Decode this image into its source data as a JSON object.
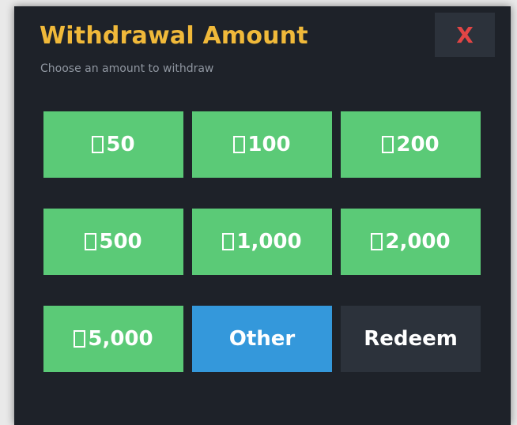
{
  "dialog": {
    "title": "Withdrawal Amount",
    "subtitle": "Choose an amount to withdraw",
    "close_label": "X"
  },
  "amounts": [
    {
      "label": "50",
      "currency_icon": "currency-glyph-box",
      "color": "#5bca77"
    },
    {
      "label": "100",
      "currency_icon": "currency-glyph-box",
      "color": "#5bca77"
    },
    {
      "label": "200",
      "currency_icon": "currency-glyph-box",
      "color": "#5bca77"
    },
    {
      "label": "500",
      "currency_icon": "currency-glyph-box",
      "color": "#5bca77"
    },
    {
      "label": "1,000",
      "currency_icon": "currency-glyph-box",
      "color": "#5bca77"
    },
    {
      "label": "2,000",
      "currency_icon": "currency-glyph-box",
      "color": "#5bca77"
    },
    {
      "label": "5,000",
      "currency_icon": "currency-glyph-box",
      "color": "#5bca77"
    }
  ],
  "other_button": {
    "label": "Other",
    "color": "#3498db"
  },
  "redeem_button": {
    "label": "Redeem",
    "color": "#2c323b"
  },
  "colors": {
    "background": "#1e2229",
    "title": "#f0b93a",
    "close_text": "#e24545",
    "subtitle": "#8f96a0"
  }
}
